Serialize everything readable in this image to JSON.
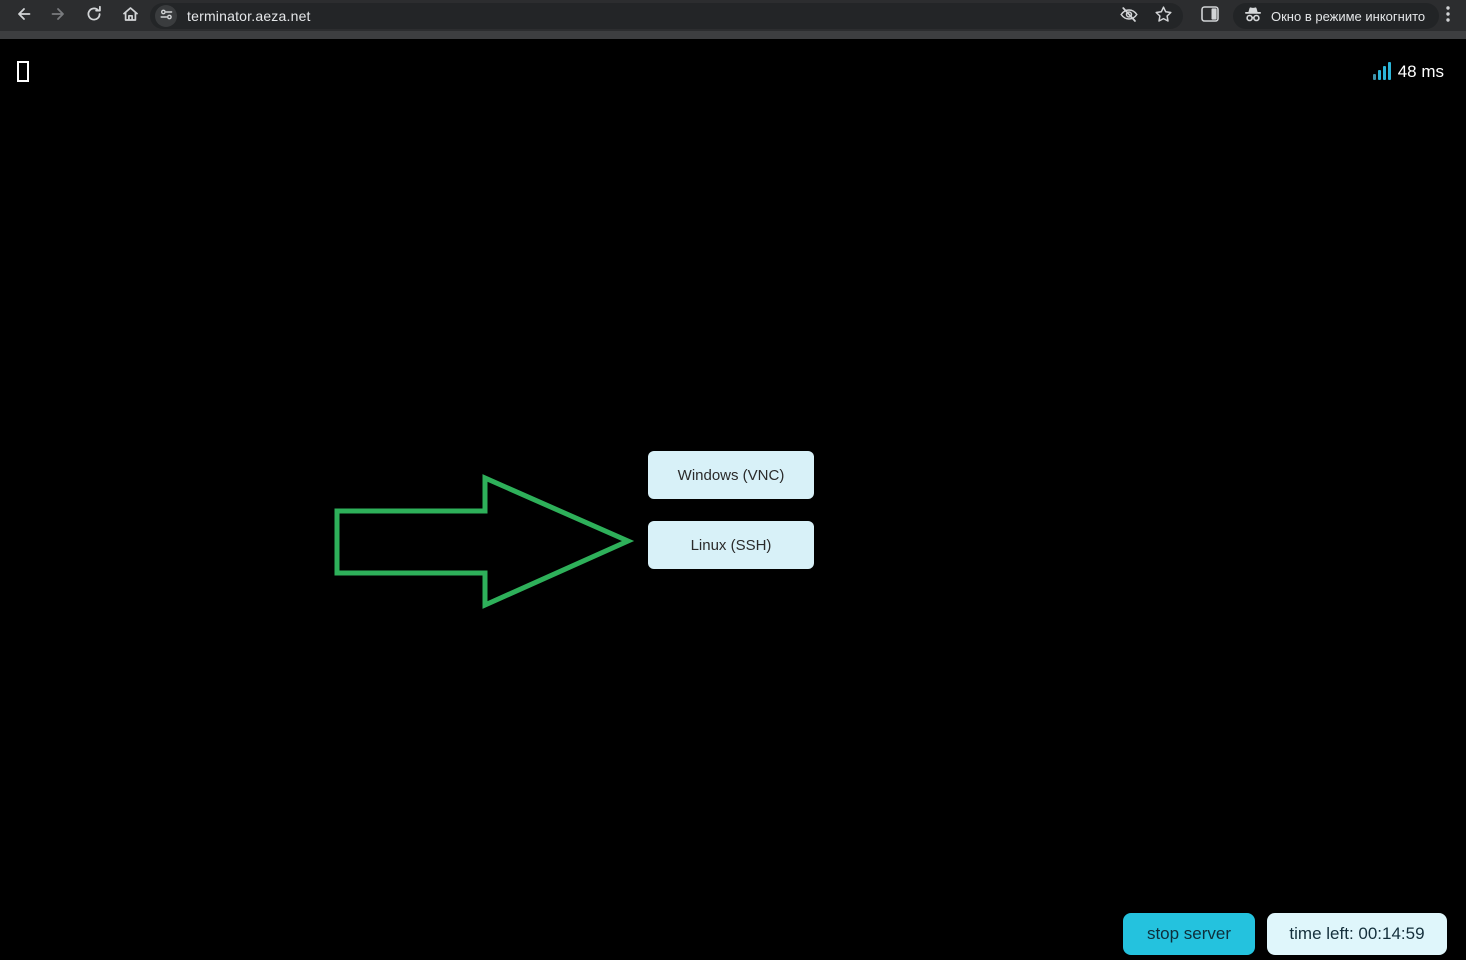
{
  "browser": {
    "toolbar": {
      "url": "terminator.aeza.net",
      "incognito_label": "Окно в режиме инкогнито"
    }
  },
  "page": {
    "ping": "48 ms",
    "os_buttons": [
      {
        "label": "Windows (VNC)"
      },
      {
        "label": "Linux (SSH)"
      }
    ],
    "stop_button_label": "stop server",
    "time_left_label": "time left: 00:14:59"
  },
  "icons": {
    "back": "back-arrow",
    "forward": "forward-arrow (disabled)",
    "reload": "reload-circular-arrow",
    "home": "home-house",
    "site_settings": "tune-sliders",
    "password_hidden": "eye-off",
    "bookmark": "star-outline",
    "side_panel": "side-panel-rect",
    "incognito": "spy-hat-glasses",
    "menu": "kebab-three-dots",
    "ping_signal": "signal-bars",
    "missing_glyph": "tofu-box",
    "pointer": "green-outline-arrow-right"
  },
  "colors": {
    "toolbar_bg": "#2c2d2f",
    "omnibox_bg": "#232527",
    "page_bg": "#000000",
    "accent_cyan": "#24c2de",
    "os_button_bg": "#d8f1f8",
    "time_pill_bg": "#dff6fb",
    "arrow_green": "#2eb05a",
    "ping_icon_cyan": "#2cb5d8"
  }
}
